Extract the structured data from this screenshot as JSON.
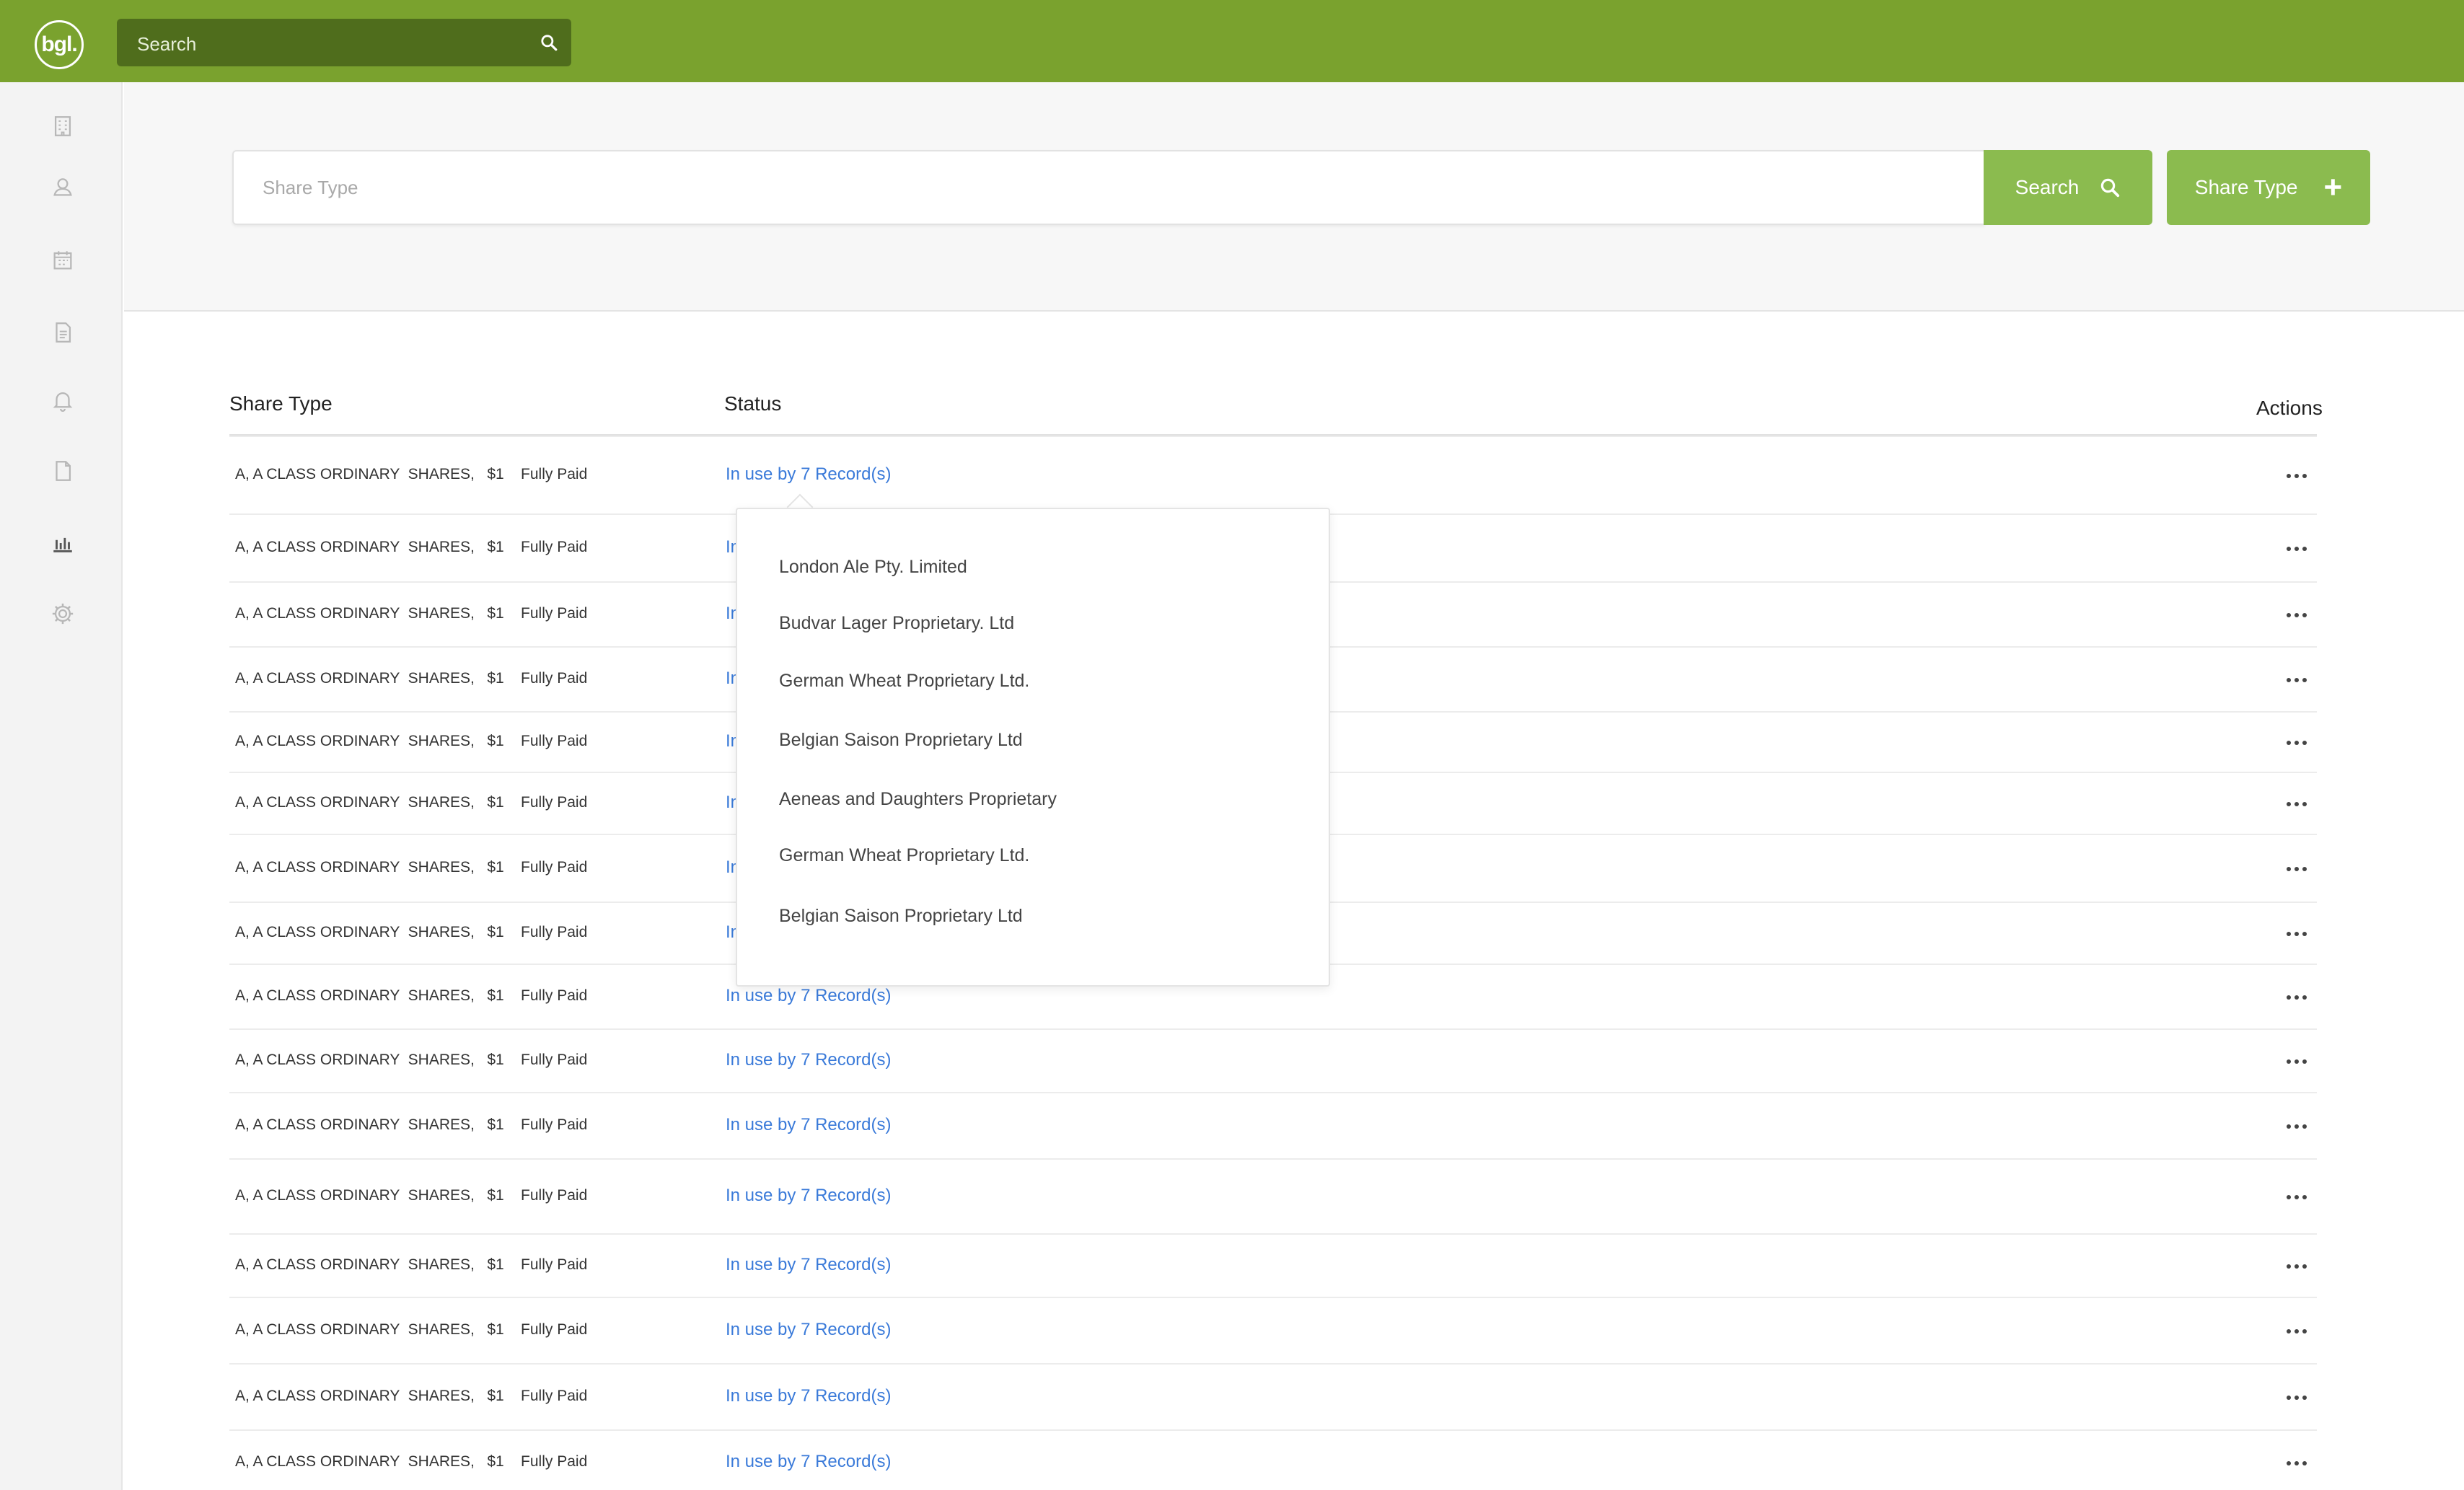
{
  "brand": {
    "logo_text": "bgl.",
    "accent": "#7aa22e",
    "button_green": "#8bbb4f",
    "link_blue": "#3a7ad9"
  },
  "global_search": {
    "placeholder": "Search"
  },
  "sidebar": {
    "items": [
      {
        "icon": "building-icon"
      },
      {
        "icon": "user-icon"
      },
      {
        "icon": "calendar-icon"
      },
      {
        "icon": "document-list-icon"
      },
      {
        "icon": "bell-icon"
      },
      {
        "icon": "file-icon"
      },
      {
        "icon": "bar-chart-icon"
      },
      {
        "icon": "gear-icon"
      }
    ]
  },
  "filter": {
    "placeholder": "Share Type",
    "search_label": "Search",
    "add_label": "Share Type"
  },
  "table": {
    "headers": {
      "share_type": "Share Type",
      "status": "Status",
      "actions": "Actions"
    },
    "rows": [
      {
        "type": "A, A CLASS ORDINARY  SHARES,   $1    Fully Paid",
        "status": "In use by 7 Record(s)"
      },
      {
        "type": "A, A CLASS ORDINARY  SHARES,   $1    Fully Paid",
        "status": "In use by 7 Record(s)"
      },
      {
        "type": "A, A CLASS ORDINARY  SHARES,   $1    Fully Paid",
        "status": "In use by 7 Record(s)"
      },
      {
        "type": "A, A CLASS ORDINARY  SHARES,   $1    Fully Paid",
        "status": "In use by 7 Record(s)"
      },
      {
        "type": "A, A CLASS ORDINARY  SHARES,   $1    Fully Paid",
        "status": "In use by 7 Record(s)"
      },
      {
        "type": "A, A CLASS ORDINARY  SHARES,   $1    Fully Paid",
        "status": "In use by 7 Record(s)"
      },
      {
        "type": "A, A CLASS ORDINARY  SHARES,   $1    Fully Paid",
        "status": "In use by 7 Record(s)"
      },
      {
        "type": "A, A CLASS ORDINARY  SHARES,   $1    Fully Paid",
        "status": "In use by 7 Record(s)"
      },
      {
        "type": "A, A CLASS ORDINARY  SHARES,   $1    Fully Paid",
        "status": "In use by 7 Record(s)"
      },
      {
        "type": "A, A CLASS ORDINARY  SHARES,   $1    Fully Paid",
        "status": "In use by 7 Record(s)"
      },
      {
        "type": "A, A CLASS ORDINARY  SHARES,   $1    Fully Paid",
        "status": "In use by 7 Record(s)"
      },
      {
        "type": "A, A CLASS ORDINARY  SHARES,   $1    Fully Paid",
        "status": "In use by 7 Record(s)"
      },
      {
        "type": "A, A CLASS ORDINARY  SHARES,   $1    Fully Paid",
        "status": "In use by 7 Record(s)"
      },
      {
        "type": "A, A CLASS ORDINARY  SHARES,   $1    Fully Paid",
        "status": "In use by 7 Record(s)"
      },
      {
        "type": "A, A CLASS ORDINARY  SHARES,   $1    Fully Paid",
        "status": "In use by 7 Record(s)"
      },
      {
        "type": "A, A CLASS ORDINARY  SHARES,   $1    Fully Paid",
        "status": "In use by 7 Record(s)"
      }
    ]
  },
  "popover": {
    "items": [
      "London Ale Pty. Limited",
      "Budvar Lager Proprietary. Ltd",
      "German Wheat Proprietary Ltd.",
      "Belgian Saison Proprietary Ltd",
      "Aeneas and Daughters Proprietary",
      "German Wheat Proprietary Ltd.",
      "Belgian Saison Proprietary Ltd"
    ]
  }
}
